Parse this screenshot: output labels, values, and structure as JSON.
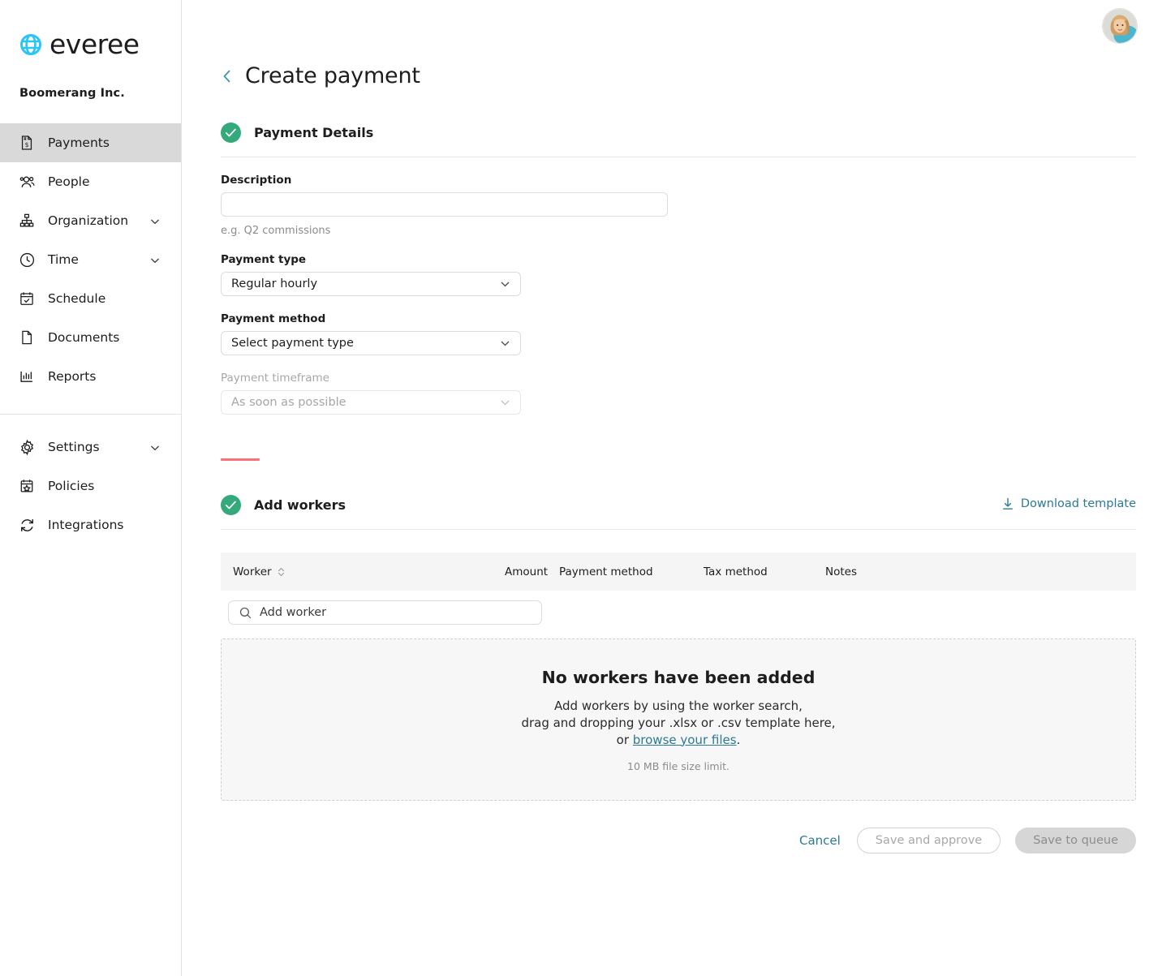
{
  "brand": {
    "name": "everee",
    "logo_icon": "globe-icon",
    "logo_color": "#29c5f6",
    "org_name": "Boomerang Inc."
  },
  "sidebar": {
    "primary_items": [
      {
        "label": "Payments",
        "icon": "document-dollar-icon",
        "active": true,
        "expandable": false
      },
      {
        "label": "People",
        "icon": "people-icon",
        "active": false,
        "expandable": false
      },
      {
        "label": "Organization",
        "icon": "org-chart-icon",
        "active": false,
        "expandable": true
      },
      {
        "label": "Time",
        "icon": "clock-icon",
        "active": false,
        "expandable": true
      },
      {
        "label": "Schedule",
        "icon": "calendar-check-icon",
        "active": false,
        "expandable": false
      },
      {
        "label": "Documents",
        "icon": "document-icon",
        "active": false,
        "expandable": false
      },
      {
        "label": "Reports",
        "icon": "bar-chart-icon",
        "active": false,
        "expandable": false
      }
    ],
    "secondary_items": [
      {
        "label": "Settings",
        "icon": "gear-icon",
        "active": false,
        "expandable": true
      },
      {
        "label": "Policies",
        "icon": "calendar-star-icon",
        "active": false,
        "expandable": false
      },
      {
        "label": "Integrations",
        "icon": "sync-icon",
        "active": false,
        "expandable": false
      }
    ]
  },
  "header": {
    "back_icon": "chevron-left-icon",
    "title": "Create payment",
    "avatar_icon": "user-avatar"
  },
  "payment_details": {
    "status_icon": "check-circle-icon",
    "status_color": "#34a97b",
    "title": "Payment Details",
    "description": {
      "label": "Description",
      "value": "",
      "placeholder": "",
      "hint": "e.g. Q2 commissions"
    },
    "payment_type": {
      "label": "Payment type",
      "value": "Regular hourly",
      "disabled": false
    },
    "payment_method": {
      "label": "Payment method",
      "value": "Select payment type",
      "disabled": false
    },
    "payment_timeframe": {
      "label": "Payment timeframe",
      "value": "As soon as possible",
      "disabled": true
    },
    "divider_color": "#fa7179"
  },
  "add_workers": {
    "status_icon": "check-circle-icon",
    "status_color": "#34a97b",
    "title": "Add workers",
    "download_template": {
      "label": "Download template",
      "icon": "download-icon",
      "color": "#2b7a96"
    },
    "table": {
      "columns": [
        "Worker",
        "Amount",
        "Payment method",
        "Tax method",
        "Notes"
      ],
      "sort_icon": "sort-arrows-icon",
      "rows": []
    },
    "search": {
      "icon": "search-icon",
      "placeholder": "Add worker",
      "value": ""
    },
    "empty_state": {
      "title": "No workers have been added",
      "line1": "Add workers by using the worker search,",
      "line2": "drag and dropping your .xlsx or .csv template here,",
      "line3_prefix": "or ",
      "line3_link": "browse your files",
      "line3_suffix": ".",
      "note": "10 MB file size limit."
    }
  },
  "actions": {
    "cancel": "Cancel",
    "save_and_approve": "Save and approve",
    "save_to_queue": "Save to queue",
    "link_color": "#2b7a96"
  }
}
